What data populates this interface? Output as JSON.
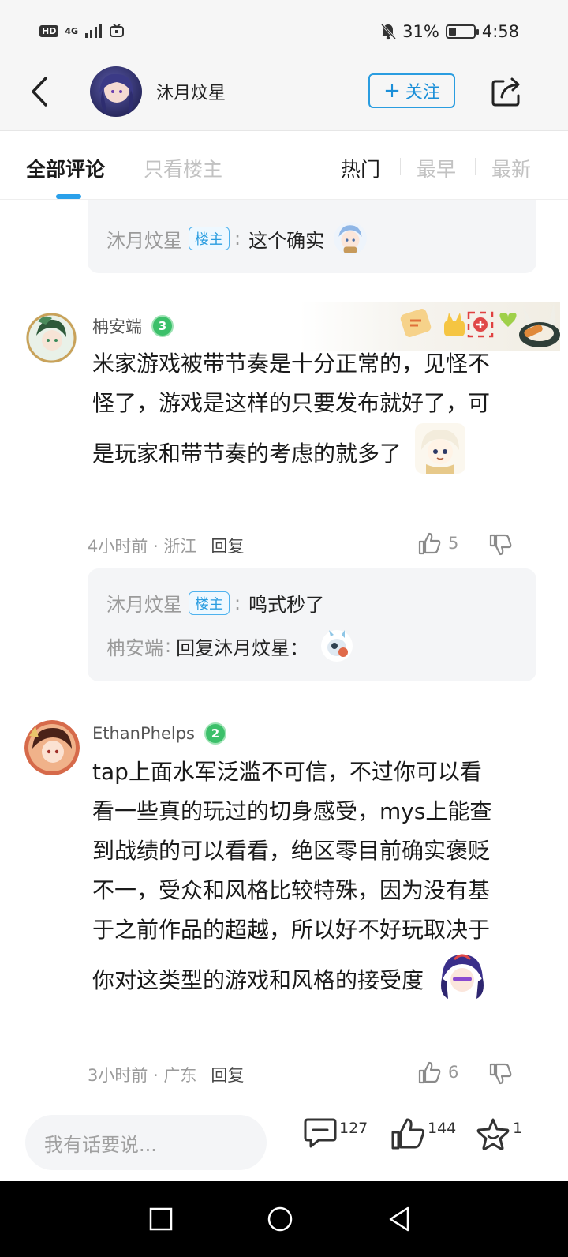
{
  "status_bar": {
    "hd": "HD",
    "network": "4G",
    "battery_percent": "31%",
    "battery_level": 0.31,
    "time": "4:58"
  },
  "header": {
    "name": "沐月炆星",
    "follow_label": "关注",
    "follow_plus": "+"
  },
  "tabs": {
    "all": "全部评论",
    "op_only": "只看楼主",
    "sort_hot": "热门",
    "sort_earliest": "最早",
    "sort_newest": "最新"
  },
  "top_reply": {
    "author": "沐月炆星",
    "badge": "楼主",
    "text": "这个确实"
  },
  "comments": [
    {
      "author": "柟安端",
      "level": "3",
      "text": "米家游戏被带节奏是十分正常的，见怪不怪了，游戏是这样的只要发布就好了，可是玩家和带节奏的考虑的就多了",
      "time": "4小时前",
      "region": "浙江",
      "reply_label": "回复",
      "likes": "5",
      "replies": [
        {
          "author": "沐月炆星",
          "badge": "楼主",
          "text": "鸣式秒了"
        },
        {
          "author": "柟安端",
          "text": "回复沐月炆星："
        }
      ]
    },
    {
      "author": "EthanPhelps",
      "level": "2",
      "text": "tap上面水军泛滥不可信，不过你可以看看一些真的玩过的切身感受，mys上能查到战绩的可以看看，绝区零目前确实褒贬不一，受众和风格比较特殊，因为没有基于之前作品的超越，所以好不好玩取决于你对这类型的游戏和风格的接受度",
      "time": "3小时前",
      "region": "广东",
      "reply_label": "回复",
      "likes": "6"
    }
  ],
  "bottom_bar": {
    "input_placeholder": "我有话要说...",
    "comment_count": "127",
    "like_count": "144",
    "favorite_count": "1"
  },
  "colors": {
    "accent": "#2a9de0",
    "level_badge": "#3cc06a",
    "muted_text": "#9a9a9a"
  }
}
